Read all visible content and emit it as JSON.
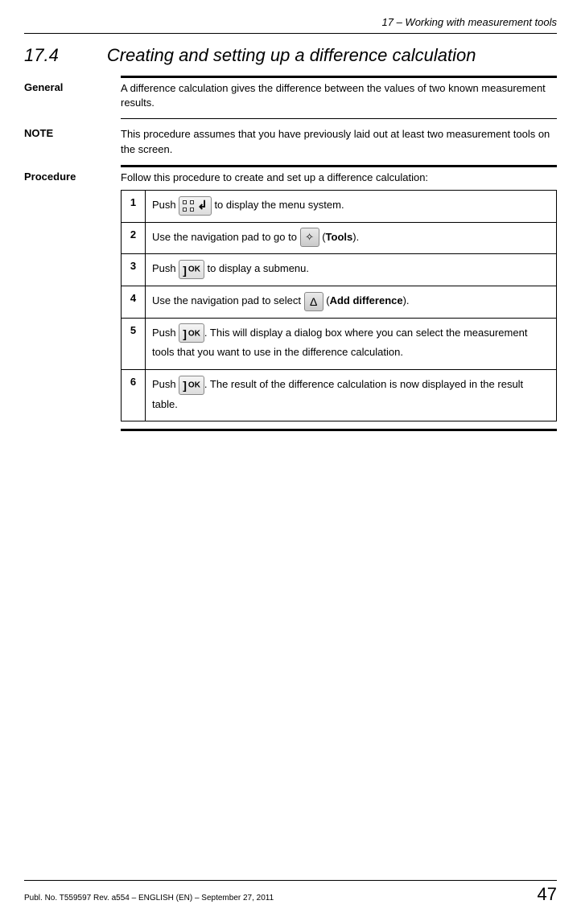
{
  "header": {
    "chapter": "17 – Working with measurement tools"
  },
  "heading": {
    "number": "17.4",
    "title": "Creating and setting up a difference calculation"
  },
  "general": {
    "label": "General",
    "text": "A difference calculation gives the difference between the values of two known measurement results."
  },
  "note": {
    "label": "NOTE",
    "text": "This procedure assumes that you have previously laid out at least two measurement tools on the screen."
  },
  "procedure": {
    "label": "Procedure",
    "intro": "Follow this procedure to create and set up a difference calculation:",
    "steps": [
      {
        "num": "1",
        "before": "Push ",
        "after": " to display the menu system."
      },
      {
        "num": "2",
        "before": "Use the navigation pad to go to ",
        "after_open": " (",
        "bold": "Tools",
        "after_close": ")."
      },
      {
        "num": "3",
        "before": "Push ",
        "after": " to display a submenu."
      },
      {
        "num": "4",
        "before": "Use the navigation pad to select ",
        "after_open": " (",
        "bold": "Add difference",
        "after_close": ")."
      },
      {
        "num": "5",
        "before": "Push ",
        "after": ". This will display a dialog box where you can select the measurement tools that you want to use in the difference calculation."
      },
      {
        "num": "6",
        "before": "Push ",
        "after": ". The result of the difference calculation is now displayed in the result table."
      }
    ]
  },
  "footer": {
    "pub": "Publ. No. T559597 Rev. a554 – ENGLISH (EN) – September 27, 2011",
    "page": "47"
  }
}
